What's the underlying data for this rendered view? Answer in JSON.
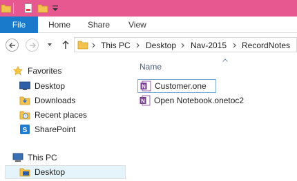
{
  "ribbon": {
    "file_label": "File",
    "tabs": [
      "Home",
      "Share",
      "View"
    ]
  },
  "address": {
    "crumbs": [
      "This PC",
      "Desktop",
      "Nav-2015",
      "RecordNotes"
    ]
  },
  "nav": {
    "favorites_label": "Favorites",
    "favorites": [
      "Desktop",
      "Downloads",
      "Recent places",
      "SharePoint"
    ],
    "this_pc_label": "This PC",
    "this_pc_items": [
      "Desktop"
    ]
  },
  "content": {
    "column_name": "Name",
    "files": [
      "Customer.one",
      "Open Notebook.onetoc2"
    ]
  },
  "colors": {
    "titlebar": "#e6588f",
    "file_tab": "#1979ca",
    "selection": "#e5f3fb",
    "header_text": "#4c607a"
  },
  "icons": {
    "qat": [
      "folder-icon",
      "properties-icon",
      "new-folder-icon",
      "customize-dropdown-icon"
    ],
    "nav": [
      "back-icon",
      "forward-icon",
      "recent-locations-icon",
      "up-icon"
    ],
    "favorites": [
      "desktop-icon",
      "downloads-icon",
      "recent-places-icon",
      "sharepoint-icon"
    ],
    "files": [
      "onenote-section-icon",
      "onenote-notebook-icon"
    ]
  }
}
